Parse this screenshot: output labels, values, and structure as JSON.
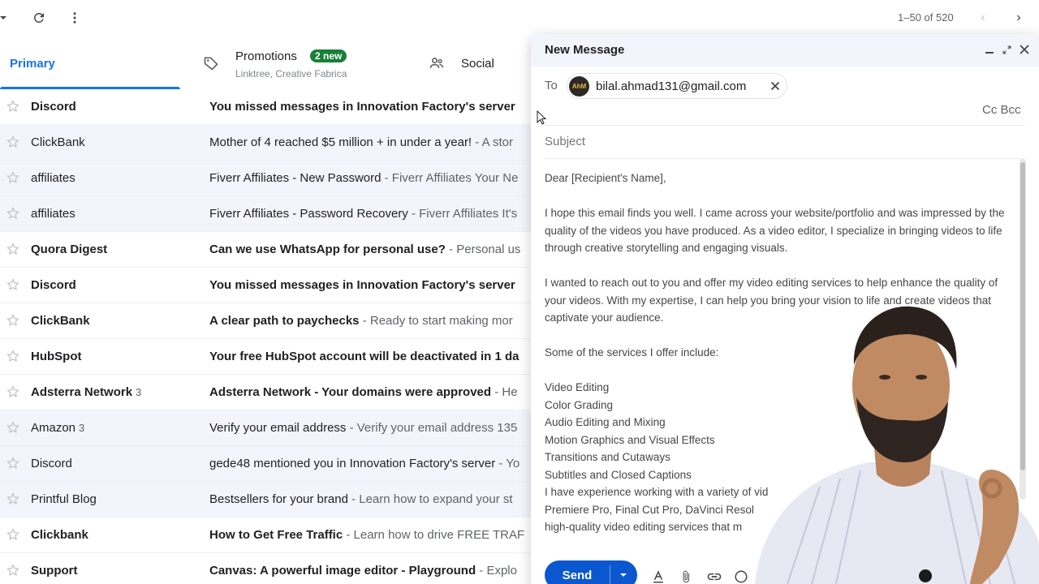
{
  "toolbar": {
    "pager_text": "1–50 of 520"
  },
  "tabs": {
    "primary": "Primary",
    "promotions": "Promotions",
    "promotions_badge": "2 new",
    "promotions_sub": "Linktree, Creative Fabrica",
    "social": "Social"
  },
  "emails": [
    {
      "sender": "Discord",
      "count": "",
      "subject": "You missed messages in Innovation Factory's server",
      "snippet": "",
      "unread": true
    },
    {
      "sender": "ClickBank",
      "count": "",
      "subject": "Mother of 4 reached $5 million + in under a year!",
      "snippet": " - A stor",
      "unread": false
    },
    {
      "sender": "affiliates",
      "count": "",
      "subject": "Fiverr Affiliates - New Password",
      "snippet": " - Fiverr Affiliates Your Ne",
      "unread": false
    },
    {
      "sender": "affiliates",
      "count": "",
      "subject": "Fiverr Affiliates - Password Recovery",
      "snippet": " - Fiverr Affiliates It's",
      "unread": false
    },
    {
      "sender": "Quora Digest",
      "count": "",
      "subject": "Can we use WhatsApp for personal use?",
      "snippet": " - Personal us",
      "unread": true
    },
    {
      "sender": "Discord",
      "count": "",
      "subject": "You missed messages in Innovation Factory's server",
      "snippet": "",
      "unread": true
    },
    {
      "sender": "ClickBank",
      "count": "",
      "subject": "A clear path to paychecks",
      "snippet": " - Ready to start making mor",
      "unread": true
    },
    {
      "sender": "HubSpot",
      "count": "",
      "subject": "Your free HubSpot account will be deactivated in 1 da",
      "snippet": "",
      "unread": true
    },
    {
      "sender": "Adsterra Network",
      "count": "3",
      "subject": "Adsterra Network - Your domains were approved",
      "snippet": " - He",
      "unread": true
    },
    {
      "sender": "Amazon",
      "count": "3",
      "subject": "Verify your email address",
      "snippet": " - Verify your email address 135",
      "unread": false
    },
    {
      "sender": "Discord",
      "count": "",
      "subject": "gede48 mentioned you in Innovation Factory's server",
      "snippet": " - Yo",
      "unread": false
    },
    {
      "sender": "Printful Blog",
      "count": "",
      "subject": "Bestsellers for your brand",
      "snippet": " - Learn how to expand your st",
      "unread": false
    },
    {
      "sender": "Clickbank",
      "count": "",
      "subject": "How to Get Free Traffic",
      "snippet": " - Learn how to drive FREE TRAF",
      "unread": true
    },
    {
      "sender": "Support",
      "count": "",
      "subject": "Canvas: A powerful image editor - Playground",
      "snippet": " - Explo",
      "unread": true
    }
  ],
  "compose": {
    "title": "New Message",
    "to_label": "To",
    "recipient": "bilal.ahmad131@gmail.com",
    "avatar_text": "AhM",
    "cc_bcc": "Cc Bcc",
    "subject_placeholder": "Subject",
    "greeting": "Dear [Recipient's Name],",
    "para1": "I hope this email finds you well. I came across your website/portfolio and was impressed by the quality of the videos you have produced. As a video editor, I specialize in bringing videos to life through creative storytelling and engaging visuals.",
    "para2": "I wanted to reach out to you and offer my video editing services to help enhance the quality of your videos. With my expertise, I can help you bring your vision to life and create videos that captivate your audience.",
    "para3": "Some of the services I offer include:",
    "services": [
      "Video Editing",
      "Color Grading",
      "Audio Editing and Mixing",
      "Motion Graphics and Visual Effects",
      "Transitions and Cutaways",
      "Subtitles and Closed Captions"
    ],
    "tail1": "I have experience working with a variety of vid",
    "tail2": "Premiere Pro, Final Cut Pro, DaVinci Resol",
    "tail3": "high-quality video editing services that m",
    "send_label": "Send"
  },
  "colors": {
    "accent": "#1a73e8",
    "send_button": "#0b57d0",
    "badge": "#188038"
  }
}
